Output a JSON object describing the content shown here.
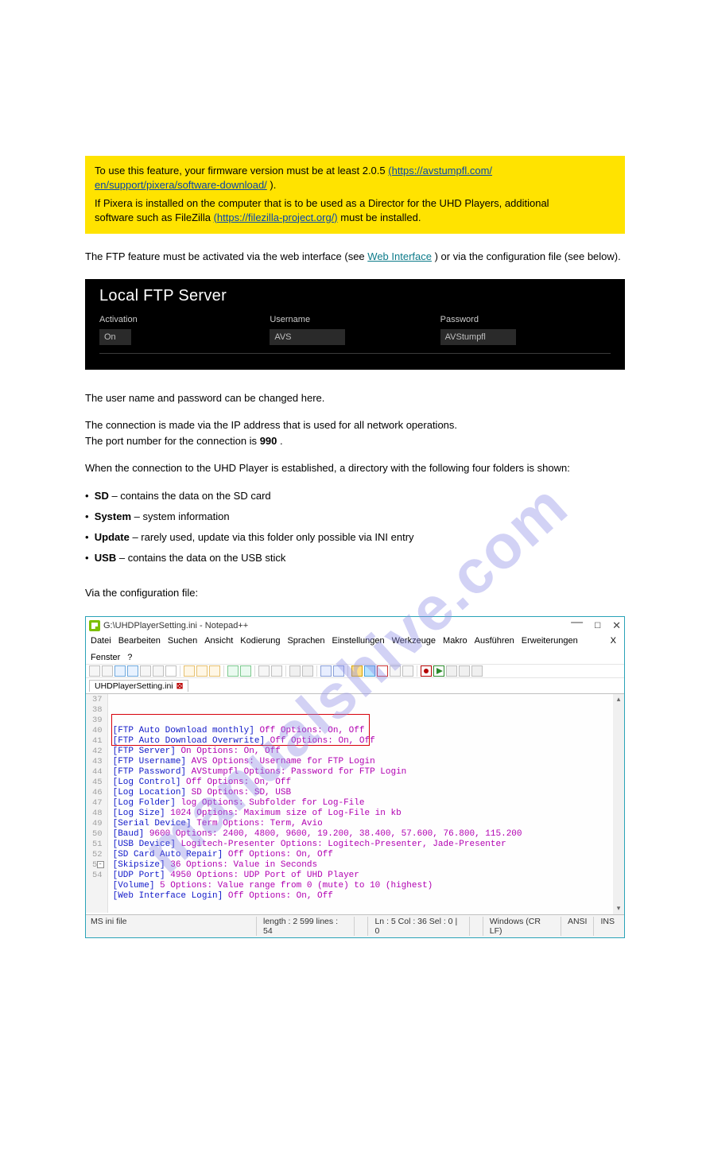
{
  "watermark": "manualshive.com",
  "info_box": {
    "line1_pre": "To use this feature, your firmware version must be at least",
    "line1_min": "2.0.5",
    "line1_link_text": "(https://avstumpfl.com/",
    "line1_link_tail": "en/support/pixera/software-download/",
    "line1_post": ").",
    "line2": "If Pixera is installed on the computer that is to be used as a Director for the UHD Players, additional",
    "line3_pre": "software such as FileZilla",
    "line3_link": "(https://filezilla-project.org/)",
    "line3_post": "must be installed."
  },
  "under1": "The FTP feature must be activated via the web interface (see ",
  "under_link": "Web Interface",
  "under2": ") or via the configuration file (see below).",
  "panel": {
    "title": "Local FTP Server",
    "col1_label": "Activation",
    "col1_val": "On",
    "col2_label": "Username",
    "col2_val": "AVS",
    "col3_label": "Password",
    "col3_val": "AVStumpfl"
  },
  "body1": "The user name and password can be changed here.",
  "body2a": "The connection is made via the IP address that is used for all network operations.",
  "body2b_pre": "The port number for the connection is",
  "body2b_port": "990",
  "body2b_post": ".",
  "body3": "When the connection to the UHD Player is established, a directory with the following four folders is shown:",
  "bullets": [
    "SD – contains the data on the SD card",
    "System – system information",
    "Update – rarely used, update via this folder only possible via INI entry",
    "USB – contains the data on the USB stick"
  ],
  "via_config": "Via the configuration file:",
  "npp": {
    "title": "G:\\UHDPlayerSetting.ini - Notepad++",
    "menus": [
      "Datei",
      "Bearbeiten",
      "Suchen",
      "Ansicht",
      "Kodierung",
      "Sprachen",
      "Einstellungen",
      "Werkzeuge",
      "Makro",
      "Ausführen",
      "Erweiterungen",
      "Fenster",
      "?"
    ],
    "tab": "UHDPlayerSetting.ini",
    "lines": [
      {
        "n": 37,
        "k": "[FTP Auto Download monthly]",
        "v": "Off Options: On, Off"
      },
      {
        "n": 38,
        "k": "[FTP Auto Download Overwrite]",
        "v": "Off Options: On, Off"
      },
      {
        "n": 39,
        "k": "[FTP Server]",
        "v": "On Options: On, Off"
      },
      {
        "n": 40,
        "k": "[FTP Username]",
        "v": "AVS Options: Username for FTP Login"
      },
      {
        "n": 41,
        "k": "[FTP Password]",
        "v": "AVStumpfl Options: Password for FTP Login"
      },
      {
        "n": 42,
        "k": "[Log Control]",
        "v": "Off Options: On, Off"
      },
      {
        "n": 43,
        "k": "[Log Location]",
        "v": "SD Options: SD, USB"
      },
      {
        "n": 44,
        "k": "[Log Folder]",
        "v": "log Options: Subfolder for Log-File"
      },
      {
        "n": 45,
        "k": "[Log Size]",
        "v": "1024 Options: Maximum size of Log-File in kb"
      },
      {
        "n": 46,
        "k": "[Serial Device]",
        "v": "Term Options: Term, Avio"
      },
      {
        "n": 47,
        "k": "[Baud]",
        "v": "9600 Options: 2400, 4800, 9600, 19.200, 38.400, 57.600, 76.800, 115.200"
      },
      {
        "n": 48,
        "k": "[USB Device]",
        "v": "Logitech-Presenter Options: Logitech-Presenter, Jade-Presenter"
      },
      {
        "n": 49,
        "k": "[SD Card Auto Repair]",
        "v": "Off Options: On, Off"
      },
      {
        "n": 50,
        "k": "[Skipsize]",
        "v": "36 Options: Value in Seconds"
      },
      {
        "n": 51,
        "k": "[UDP Port]",
        "v": "4950 Options: UDP Port of UHD Player"
      },
      {
        "n": 52,
        "k": "[Volume]",
        "v": "5 Options: Value range from 0 (mute) to 10 (highest)"
      },
      {
        "n": 53,
        "k": "[Web Interface Login]",
        "v": "Off Options: On, Off"
      },
      {
        "n": 54,
        "k": "",
        "v": ""
      }
    ],
    "status": {
      "type": "MS ini file",
      "len": "length : 2 599    lines : 54",
      "pos": "Ln : 5    Col : 36    Sel : 0 | 0",
      "eol": "Windows (CR LF)",
      "enc": "ANSI",
      "ins": "INS"
    }
  }
}
